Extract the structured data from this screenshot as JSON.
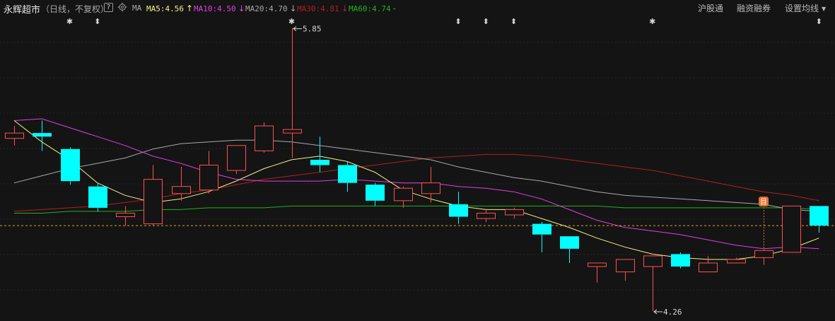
{
  "stock": {
    "name": "永辉超市",
    "period": "（日线，不复权）",
    "help_label": "?"
  },
  "indicator": {
    "name": "MA",
    "items": [
      {
        "label": "MA5:4.56",
        "arrow": "↑",
        "color": "#f5f08a"
      },
      {
        "label": "MA10:4.50",
        "arrow": "↓",
        "color": "#e040e0"
      },
      {
        "label": "MA20:4.70",
        "arrow": "↓",
        "color": "#a8a8a8"
      },
      {
        "label": "MA30:4.81",
        "arrow": "↓",
        "color": "#b02020"
      },
      {
        "label": "MA60:4.74",
        "arrow": "-",
        "color": "#20b020"
      }
    ]
  },
  "actions": {
    "hgt_label": "沪股通",
    "margin_label": "融资融券",
    "ma_settings_label": "设置均线"
  },
  "chart_data": {
    "type": "candlestick",
    "colors": {
      "up": "#ff5050",
      "down": "#00ffff",
      "ma5": "#f5f08a",
      "ma10": "#e040e0",
      "ma20": "#a8a8a8",
      "ma30": "#b02020",
      "ma60": "#20b020",
      "reference_line": "#e0a020"
    },
    "y_range": [
      4.22,
      5.92
    ],
    "candles": [
      {
        "o": 5.23,
        "h": 5.3,
        "l": 5.19,
        "c": 5.26
      },
      {
        "o": 5.26,
        "h": 5.33,
        "l": 5.16,
        "c": 5.24
      },
      {
        "o": 5.17,
        "h": 5.18,
        "l": 4.97,
        "c": 4.99
      },
      {
        "o": 4.96,
        "h": 4.98,
        "l": 4.82,
        "c": 4.84
      },
      {
        "o": 4.79,
        "h": 4.85,
        "l": 4.74,
        "c": 4.81
      },
      {
        "o": 4.75,
        "h": 5.08,
        "l": 4.74,
        "c": 5.0
      },
      {
        "o": 4.92,
        "h": 5.07,
        "l": 4.88,
        "c": 4.96
      },
      {
        "o": 4.94,
        "h": 5.16,
        "l": 4.92,
        "c": 5.08
      },
      {
        "o": 5.05,
        "h": 5.18,
        "l": 5.03,
        "c": 5.19
      },
      {
        "o": 5.16,
        "h": 5.32,
        "l": 5.15,
        "c": 5.3
      },
      {
        "o": 5.26,
        "h": 5.85,
        "l": 5.12,
        "c": 5.28
      },
      {
        "o": 5.11,
        "h": 5.24,
        "l": 5.04,
        "c": 5.08
      },
      {
        "o": 5.08,
        "h": 5.1,
        "l": 4.93,
        "c": 4.98
      },
      {
        "o": 4.97,
        "h": 4.98,
        "l": 4.85,
        "c": 4.88
      },
      {
        "o": 4.88,
        "h": 4.96,
        "l": 4.84,
        "c": 4.95
      },
      {
        "o": 4.92,
        "h": 5.07,
        "l": 4.87,
        "c": 4.98
      },
      {
        "o": 4.86,
        "h": 4.93,
        "l": 4.75,
        "c": 4.79
      },
      {
        "o": 4.78,
        "h": 4.83,
        "l": 4.76,
        "c": 4.81
      },
      {
        "o": 4.8,
        "h": 4.84,
        "l": 4.78,
        "c": 4.83
      },
      {
        "o": 4.75,
        "h": 4.76,
        "l": 4.59,
        "c": 4.69
      },
      {
        "o": 4.68,
        "h": 4.68,
        "l": 4.53,
        "c": 4.61
      },
      {
        "o": 4.51,
        "h": 4.53,
        "l": 4.42,
        "c": 4.53
      },
      {
        "o": 4.48,
        "h": 4.53,
        "l": 4.43,
        "c": 4.55
      },
      {
        "o": 4.51,
        "h": 4.57,
        "l": 4.26,
        "c": 4.57
      },
      {
        "o": 4.58,
        "h": 4.59,
        "l": 4.5,
        "c": 4.51
      },
      {
        "o": 4.48,
        "h": 4.57,
        "l": 4.48,
        "c": 4.53
      },
      {
        "o": 4.53,
        "h": 4.56,
        "l": 4.53,
        "c": 4.55
      },
      {
        "o": 4.56,
        "h": 4.6,
        "l": 4.52,
        "c": 4.6
      },
      {
        "o": 4.59,
        "h": 4.85,
        "l": 4.59,
        "c": 4.85
      },
      {
        "o": 4.85,
        "h": 4.85,
        "l": 4.7,
        "c": 4.74
      }
    ],
    "ma5": [
      5.33,
      5.21,
      5.11,
      4.98,
      4.91,
      4.87,
      4.89,
      4.93,
      4.99,
      5.06,
      5.11,
      5.13,
      5.1,
      5.04,
      4.94,
      4.89,
      4.85,
      4.83,
      4.83,
      4.78,
      4.73,
      4.67,
      4.62,
      4.58,
      4.56,
      4.55,
      4.55,
      4.57,
      4.61,
      4.67
    ],
    "ma10": [
      5.33,
      5.34,
      5.29,
      5.24,
      5.19,
      5.13,
      5.09,
      5.04,
      5.0,
      4.99,
      4.99,
      4.99,
      5.0,
      4.99,
      4.98,
      4.98,
      4.96,
      4.95,
      4.93,
      4.89,
      4.83,
      4.77,
      4.73,
      4.71,
      4.69,
      4.66,
      4.63,
      4.61,
      4.62,
      4.61
    ],
    "ma20": [
      4.98,
      5.02,
      5.06,
      5.09,
      5.12,
      5.17,
      5.2,
      5.21,
      5.22,
      5.22,
      5.21,
      5.19,
      5.17,
      5.15,
      5.13,
      5.11,
      5.07,
      5.04,
      5.01,
      4.99,
      4.96,
      4.93,
      4.91,
      4.9,
      4.89,
      4.88,
      4.87,
      4.86,
      4.83,
      4.82
    ],
    "ma30": [
      4.82,
      4.83,
      4.84,
      4.85,
      4.87,
      4.89,
      4.92,
      4.94,
      4.97,
      5.0,
      5.02,
      5.04,
      5.06,
      5.08,
      5.1,
      5.12,
      5.13,
      5.14,
      5.14,
      5.13,
      5.11,
      5.09,
      5.07,
      5.05,
      5.02,
      4.99,
      4.96,
      4.93,
      4.91,
      4.88
    ],
    "ma60": [
      4.81,
      4.81,
      4.82,
      4.82,
      4.82,
      4.83,
      4.83,
      4.84,
      4.84,
      4.84,
      4.85,
      4.85,
      4.85,
      4.85,
      4.85,
      4.85,
      4.85,
      4.85,
      4.85,
      4.85,
      4.85,
      4.85,
      4.84,
      4.84,
      4.84,
      4.84,
      4.84,
      4.84,
      4.84,
      4.83
    ],
    "reference_price": 4.74,
    "annotations": {
      "max": {
        "index": 10,
        "label": "5.85"
      },
      "min": {
        "index": 23,
        "label": "4.26"
      }
    },
    "event_markers": [
      {
        "index": 2,
        "symbol": "✱"
      },
      {
        "index": 3,
        "symbol": "⬍"
      },
      {
        "index": 10,
        "symbol": "✱"
      },
      {
        "index": 16,
        "symbol": "⬍"
      },
      {
        "index": 17,
        "symbol": "⬍"
      },
      {
        "index": 18,
        "symbol": "⬍"
      },
      {
        "index": 23,
        "symbol": "✱"
      },
      {
        "index": 29,
        "symbol": "⬍"
      }
    ],
    "tag": {
      "index": 27,
      "label": "目"
    }
  }
}
